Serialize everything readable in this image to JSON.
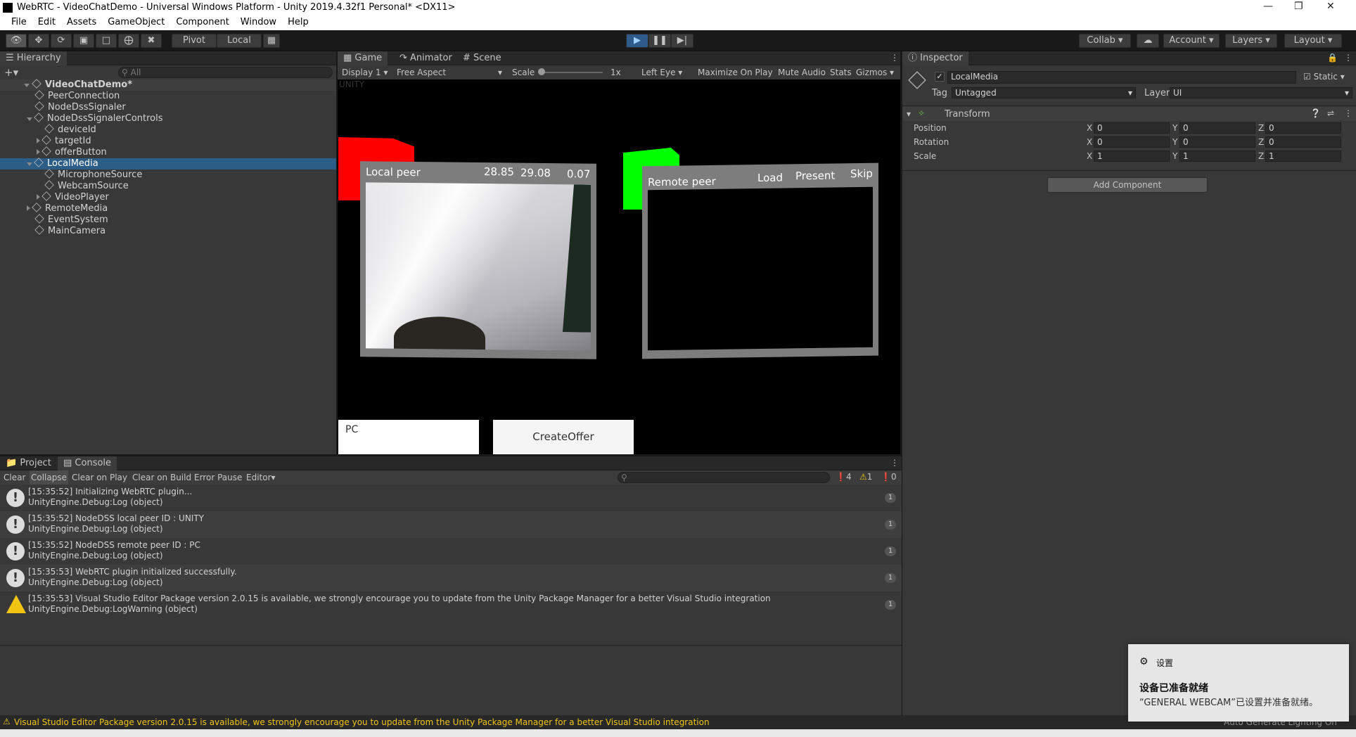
{
  "window": {
    "title": "WebRTC - VideoChatDemo - Universal Windows Platform - Unity 2019.4.32f1 Personal* <DX11>"
  },
  "menu": [
    "File",
    "Edit",
    "Assets",
    "GameObject",
    "Component",
    "Window",
    "Help"
  ],
  "toolbar": {
    "pivot": "Pivot",
    "local": "Local",
    "collab": "Collab",
    "account": "Account",
    "layers": "Layers",
    "layout": "Layout"
  },
  "hierarchy": {
    "tab": "Hierarchy",
    "search_placeholder": "All",
    "scene": "VideoChatDemo*",
    "items": [
      {
        "label": "PeerConnection",
        "depth": 1,
        "arrow": ""
      },
      {
        "label": "NodeDssSignaler",
        "depth": 1,
        "arrow": ""
      },
      {
        "label": "NodeDssSignalerControls",
        "depth": 1,
        "arrow": "down"
      },
      {
        "label": "deviceId",
        "depth": 2,
        "arrow": ""
      },
      {
        "label": "targetId",
        "depth": 2,
        "arrow": "right"
      },
      {
        "label": "offerButton",
        "depth": 2,
        "arrow": "right"
      },
      {
        "label": "LocalMedia",
        "depth": 1,
        "arrow": "down",
        "selected": true
      },
      {
        "label": "MicrophoneSource",
        "depth": 2,
        "arrow": ""
      },
      {
        "label": "WebcamSource",
        "depth": 2,
        "arrow": ""
      },
      {
        "label": "VideoPlayer",
        "depth": 2,
        "arrow": "right"
      },
      {
        "label": "RemoteMedia",
        "depth": 1,
        "arrow": "right"
      },
      {
        "label": "EventSystem",
        "depth": 1,
        "arrow": ""
      },
      {
        "label": "MainCamera",
        "depth": 1,
        "arrow": ""
      }
    ]
  },
  "game": {
    "tabs": [
      "Game",
      "Animator",
      "Scene"
    ],
    "display": "Display 1",
    "aspect": "Free Aspect",
    "scale_label": "Scale",
    "scale_value": "1x",
    "eye": "Left Eye",
    "maximize": "Maximize On Play",
    "mute": "Mute Audio",
    "stats": "Stats",
    "gizmos": "Gizmos",
    "overlay_text": "UNITY",
    "local_peer": {
      "label": "Local peer",
      "v1": "28.85",
      "v2": "29.08",
      "v3": "0.07"
    },
    "remote_peer": {
      "label": "Remote peer",
      "load": "Load",
      "present": "Present",
      "skip": "Skip"
    },
    "pc_input": "PC",
    "create_offer": "CreateOffer"
  },
  "inspector": {
    "tab": "Inspector",
    "object_name": "LocalMedia",
    "static": "Static",
    "tag_label": "Tag",
    "tag_value": "Untagged",
    "layer_label": "Layer",
    "layer_value": "UI",
    "transform": "Transform",
    "rows": [
      {
        "label": "Position",
        "x": "0",
        "y": "0",
        "z": "0"
      },
      {
        "label": "Rotation",
        "x": "0",
        "y": "0",
        "z": "0"
      },
      {
        "label": "Scale",
        "x": "1",
        "y": "1",
        "z": "1"
      }
    ],
    "add_component": "Add Component"
  },
  "console": {
    "tabs": [
      "Project",
      "Console"
    ],
    "buttons": [
      "Clear",
      "Collapse",
      "Clear on Play",
      "Clear on Build",
      "Error Pause",
      "Editor"
    ],
    "counts": {
      "info": "4",
      "warn": "1",
      "error": "0"
    },
    "logs": [
      {
        "type": "info",
        "line1": "[15:35:52] Initializing WebRTC plugin...",
        "line2": "UnityEngine.Debug:Log (object)",
        "count": "1"
      },
      {
        "type": "info",
        "line1": "[15:35:52] NodeDSS local peer ID : UNITY",
        "line2": "UnityEngine.Debug:Log (object)",
        "count": "1"
      },
      {
        "type": "info",
        "line1": "[15:35:52] NodeDSS remote peer ID : PC",
        "line2": "UnityEngine.Debug:Log (object)",
        "count": "1"
      },
      {
        "type": "info",
        "line1": "[15:35:53] WebRTC plugin initialized successfully.",
        "line2": "UnityEngine.Debug:Log (object)",
        "count": "1"
      },
      {
        "type": "warn",
        "line1": "[15:35:53] Visual Studio Editor Package version 2.0.15 is available, we strongly encourage you to update from the Unity Package Manager for a better Visual Studio integration",
        "line2": "UnityEngine.Debug:LogWarning (object)",
        "count": "1"
      }
    ]
  },
  "statusbar": {
    "message": "Visual Studio Editor Package version 2.0.15 is available, we strongly encourage you to update from the Unity Package Manager for a better Visual Studio integration",
    "right": "Auto Generate Lighting On"
  },
  "toast": {
    "app": "设置",
    "title": "设备已准备就绪",
    "body": "“GENERAL WEBCAM”已设置并准备就绪。"
  }
}
